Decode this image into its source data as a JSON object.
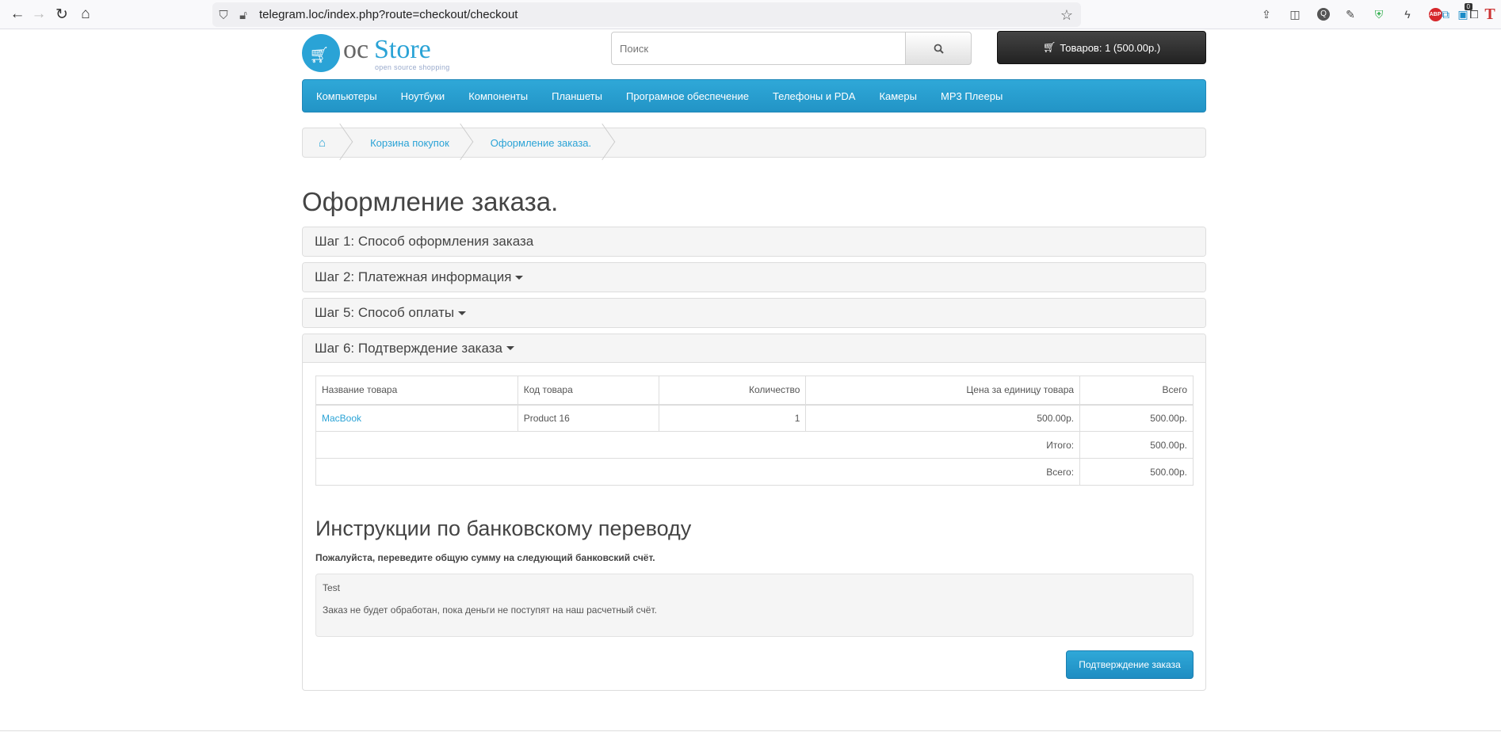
{
  "browser": {
    "url": "telegram.loc/index.php?route=checkout/checkout",
    "extensions": [
      "downloads-icon",
      "pocket-icon",
      "q-icon",
      "eyedropper-icon",
      "shield-icon",
      "bolt-icon",
      "abp-icon",
      "badge-icon",
      "t-icon",
      "translate-icon",
      "extensions-icon"
    ],
    "badge_count": "0",
    "abp_label": "ABP",
    "t_label": "T"
  },
  "logo": {
    "oc": "oc",
    "store": "Store",
    "tagline": "open source shopping"
  },
  "search": {
    "placeholder": "Поиск"
  },
  "cart": {
    "label": "Товаров: 1 (500.00р.)"
  },
  "menu": [
    "Компьютеры",
    "Ноутбуки",
    "Компоненты",
    "Планшеты",
    "Програмное обеспечение",
    "Телефоны и PDA",
    "Камеры",
    "MP3 Плееры"
  ],
  "breadcrumb": {
    "cart": "Корзина покупок",
    "checkout": "Оформление заказа."
  },
  "page_title": "Оформление заказа.",
  "steps": {
    "step1": "Шаг 1: Способ оформления заказа",
    "step2": "Шаг 2: Платежная информация",
    "step5": "Шаг 5: Способ оплаты",
    "step6": "Шаг 6: Подтверждение заказа"
  },
  "order_table": {
    "headers": [
      "Название товара",
      "Код товара",
      "Количество",
      "Цена за единицу товара",
      "Всего"
    ],
    "rows": [
      {
        "name": "MacBook",
        "model": "Product 16",
        "qty": "1",
        "price": "500.00р.",
        "total": "500.00р."
      }
    ],
    "subtotal_label": "Итого:",
    "subtotal_value": "500.00р.",
    "total_label": "Всего:",
    "total_value": "500.00р."
  },
  "bank": {
    "title": "Инструкции по банковскому переводу",
    "subtitle": "Пожалуйста, переведите общую сумму на следующий банковский счёт.",
    "account": "Test",
    "note": "Заказ не будет обработан, пока деньги не поступят на наш расчетный счёт."
  },
  "confirm_button": "Подтверждение заказа",
  "colors": {
    "accent": "#2aa3d6",
    "cart_bg": "#222222"
  }
}
